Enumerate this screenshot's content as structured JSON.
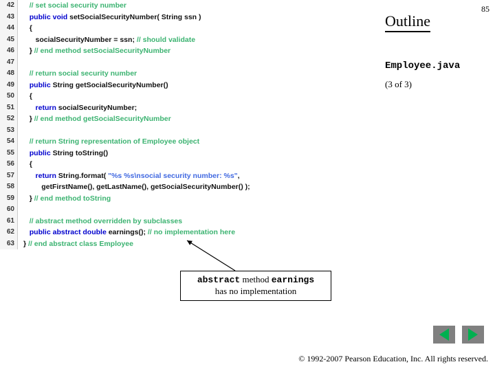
{
  "pagenum": "85",
  "outline_title": "Outline",
  "filename": "Employee.java",
  "pageof": "(3 of 3)",
  "callout": {
    "pre1": "abstract",
    "mid": " method ",
    "pre2": "earnings",
    "line2": "has no implementation"
  },
  "copyright": "© 1992-2007 Pearson Education, Inc.  All rights reserved.",
  "code": [
    {
      "n": "42",
      "tokens": [
        [
          "pl",
          "   "
        ],
        [
          "cm",
          "// set social security number"
        ]
      ]
    },
    {
      "n": "43",
      "tokens": [
        [
          "pl",
          "   "
        ],
        [
          "kw",
          "public void"
        ],
        [
          "pl",
          " setSocialSecurityNumber( String ssn )"
        ]
      ]
    },
    {
      "n": "44",
      "tokens": [
        [
          "pl",
          "   {"
        ]
      ]
    },
    {
      "n": "45",
      "tokens": [
        [
          "pl",
          "      socialSecurityNumber = ssn; "
        ],
        [
          "cm",
          "// should validate"
        ]
      ]
    },
    {
      "n": "46",
      "tokens": [
        [
          "pl",
          "   } "
        ],
        [
          "cm",
          "// end method setSocialSecurityNumber"
        ]
      ]
    },
    {
      "n": "47",
      "tokens": [
        [
          "pl",
          ""
        ]
      ]
    },
    {
      "n": "48",
      "tokens": [
        [
          "pl",
          "   "
        ],
        [
          "cm",
          "// return social security number"
        ]
      ]
    },
    {
      "n": "49",
      "tokens": [
        [
          "pl",
          "   "
        ],
        [
          "kw",
          "public"
        ],
        [
          "pl",
          " String getSocialSecurityNumber()"
        ]
      ]
    },
    {
      "n": "50",
      "tokens": [
        [
          "pl",
          "   {"
        ]
      ]
    },
    {
      "n": "51",
      "tokens": [
        [
          "pl",
          "      "
        ],
        [
          "kw",
          "return"
        ],
        [
          "pl",
          " socialSecurityNumber;"
        ]
      ]
    },
    {
      "n": "52",
      "tokens": [
        [
          "pl",
          "   } "
        ],
        [
          "cm",
          "// end method getSocialSecurityNumber"
        ]
      ]
    },
    {
      "n": "53",
      "tokens": [
        [
          "pl",
          ""
        ]
      ]
    },
    {
      "n": "54",
      "tokens": [
        [
          "pl",
          "   "
        ],
        [
          "cm",
          "// return String representation of Employee object"
        ]
      ]
    },
    {
      "n": "55",
      "tokens": [
        [
          "pl",
          "   "
        ],
        [
          "kw",
          "public"
        ],
        [
          "pl",
          " String toString()"
        ]
      ]
    },
    {
      "n": "56",
      "tokens": [
        [
          "pl",
          "   {"
        ]
      ]
    },
    {
      "n": "57",
      "tokens": [
        [
          "pl",
          "      "
        ],
        [
          "kw",
          "return"
        ],
        [
          "pl",
          " String.format( "
        ],
        [
          "st",
          "\"%s %s\\nsocial security number: %s\""
        ],
        [
          "pl",
          ","
        ]
      ]
    },
    {
      "n": "58",
      "tokens": [
        [
          "pl",
          "         getFirstName(), getLastName(), getSocialSecurityNumber() );"
        ]
      ]
    },
    {
      "n": "59",
      "tokens": [
        [
          "pl",
          "   } "
        ],
        [
          "cm",
          "// end method toString"
        ]
      ]
    },
    {
      "n": "60",
      "tokens": [
        [
          "pl",
          ""
        ]
      ]
    },
    {
      "n": "61",
      "tokens": [
        [
          "pl",
          "   "
        ],
        [
          "cm",
          "// abstract method overridden by subclasses"
        ]
      ]
    },
    {
      "n": "62",
      "tokens": [
        [
          "pl",
          "   "
        ],
        [
          "kw",
          "public abstract double"
        ],
        [
          "pl",
          " earnings(); "
        ],
        [
          "cm",
          "// no implementation here"
        ]
      ]
    },
    {
      "n": "63",
      "tokens": [
        [
          "pl",
          "} "
        ],
        [
          "cm",
          "// end abstract class Employee"
        ]
      ]
    }
  ]
}
